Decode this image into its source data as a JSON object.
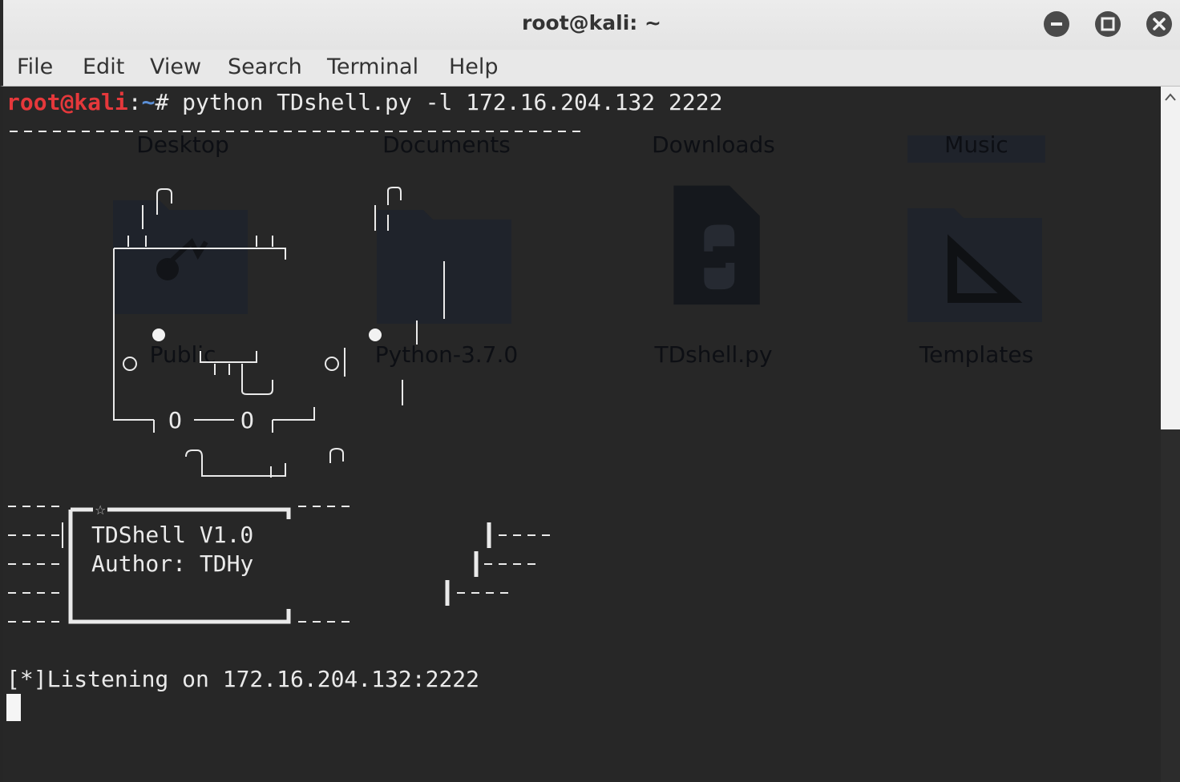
{
  "window": {
    "title": "root@kali: ~"
  },
  "menu": [
    "File",
    "Edit",
    "View",
    "Search",
    "Terminal",
    "Help"
  ],
  "desktop_icons": [
    "Desktop",
    "Documents",
    "Downloads",
    "Music",
    "Public",
    "Python-3.7.0",
    "TDshell.py",
    "Templates"
  ],
  "terminal": {
    "prompt_user": "root@kali",
    "prompt_sep": ":",
    "prompt_dir": "~",
    "prompt_hash": "# ",
    "command": "python TDshell.py -l 172.16.204.132 2222",
    "banner_name": "TDShell V1.0",
    "banner_author": "Author: TDHy",
    "listening": "[*]Listening on 172.16.204.132:2222"
  },
  "colors": {
    "prompt_user": "#e5383b",
    "prompt_dir": "#5b8fd6",
    "terminal_bg": "#272727",
    "text": "#eaeaea"
  }
}
